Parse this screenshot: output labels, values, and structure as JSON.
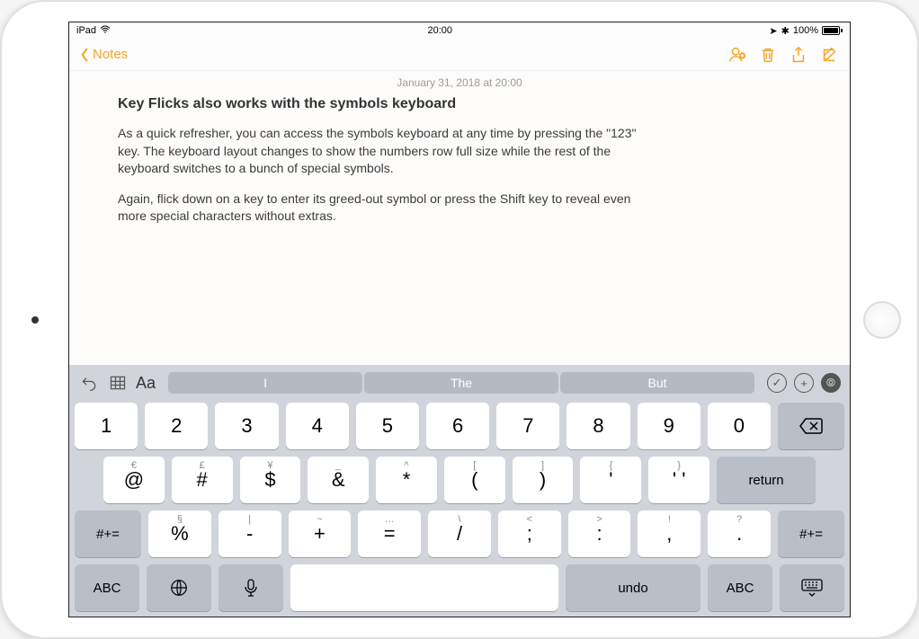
{
  "statusbar": {
    "left_label": "iPad",
    "time": "20:00",
    "battery_pct": "100%"
  },
  "toolbar": {
    "back_label": "Notes"
  },
  "note": {
    "date": "January 31, 2018 at 20:00",
    "title": "Key Flicks also works with the symbols keyboard",
    "p1": "As a quick refresher, you can access the symbols keyboard at any time by pressing the \"123\" key.  The keyboard layout changes to show the numbers row full size while the rest of the keyboard switches to a bunch of special symbols.",
    "p2": "Again, flick down on a key to enter its greed-out symbol or press the Shift key to reveal even more special characters without extras."
  },
  "keyboard": {
    "aa": "Aa",
    "suggestions": [
      "I",
      "The",
      "But"
    ],
    "row1": [
      "1",
      "2",
      "3",
      "4",
      "5",
      "6",
      "7",
      "8",
      "9",
      "0"
    ],
    "row2": [
      {
        "up": "€",
        "main": "@"
      },
      {
        "up": "£",
        "main": "#"
      },
      {
        "up": "¥",
        "main": "$"
      },
      {
        "up": "_",
        "main": "&"
      },
      {
        "up": "^",
        "main": "*"
      },
      {
        "up": "[",
        "main": "("
      },
      {
        "up": "]",
        "main": ")"
      },
      {
        "up": "{",
        "main": "'"
      },
      {
        "up": "}",
        "main": "' '"
      }
    ],
    "row3": [
      {
        "up": "§",
        "main": "%"
      },
      {
        "up": "|",
        "main": "-"
      },
      {
        "up": "~",
        "main": "+"
      },
      {
        "up": "…",
        "main": "="
      },
      {
        "up": "\\",
        "main": "/"
      },
      {
        "up": "<",
        "main": ";"
      },
      {
        "up": ">",
        "main": ":"
      },
      {
        "up": "!",
        "main": ","
      },
      {
        "up": "?",
        "main": "."
      }
    ],
    "shift_label": "#+=",
    "abc": "ABC",
    "undo": "undo",
    "return": "return",
    "plus": "+",
    "check": "✓"
  }
}
